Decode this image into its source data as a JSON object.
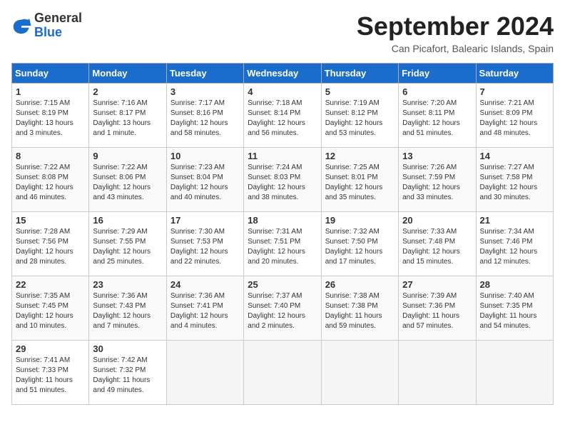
{
  "header": {
    "logo": {
      "general": "General",
      "blue": "Blue"
    },
    "title": "September 2024",
    "location": "Can Picafort, Balearic Islands, Spain"
  },
  "calendar": {
    "days_of_week": [
      "Sunday",
      "Monday",
      "Tuesday",
      "Wednesday",
      "Thursday",
      "Friday",
      "Saturday"
    ],
    "weeks": [
      [
        null,
        {
          "day": "2",
          "sunrise": "Sunrise: 7:16 AM",
          "sunset": "Sunset: 8:17 PM",
          "daylight": "Daylight: 13 hours and 1 minute."
        },
        {
          "day": "3",
          "sunrise": "Sunrise: 7:17 AM",
          "sunset": "Sunset: 8:16 PM",
          "daylight": "Daylight: 12 hours and 58 minutes."
        },
        {
          "day": "4",
          "sunrise": "Sunrise: 7:18 AM",
          "sunset": "Sunset: 8:14 PM",
          "daylight": "Daylight: 12 hours and 56 minutes."
        },
        {
          "day": "5",
          "sunrise": "Sunrise: 7:19 AM",
          "sunset": "Sunset: 8:12 PM",
          "daylight": "Daylight: 12 hours and 53 minutes."
        },
        {
          "day": "6",
          "sunrise": "Sunrise: 7:20 AM",
          "sunset": "Sunset: 8:11 PM",
          "daylight": "Daylight: 12 hours and 51 minutes."
        },
        {
          "day": "7",
          "sunrise": "Sunrise: 7:21 AM",
          "sunset": "Sunset: 8:09 PM",
          "daylight": "Daylight: 12 hours and 48 minutes."
        }
      ],
      [
        {
          "day": "1",
          "sunrise": "Sunrise: 7:15 AM",
          "sunset": "Sunset: 8:19 PM",
          "daylight": "Daylight: 13 hours and 3 minutes."
        },
        null,
        null,
        null,
        null,
        null,
        null
      ],
      [
        {
          "day": "8",
          "sunrise": "Sunrise: 7:22 AM",
          "sunset": "Sunset: 8:08 PM",
          "daylight": "Daylight: 12 hours and 46 minutes."
        },
        {
          "day": "9",
          "sunrise": "Sunrise: 7:22 AM",
          "sunset": "Sunset: 8:06 PM",
          "daylight": "Daylight: 12 hours and 43 minutes."
        },
        {
          "day": "10",
          "sunrise": "Sunrise: 7:23 AM",
          "sunset": "Sunset: 8:04 PM",
          "daylight": "Daylight: 12 hours and 40 minutes."
        },
        {
          "day": "11",
          "sunrise": "Sunrise: 7:24 AM",
          "sunset": "Sunset: 8:03 PM",
          "daylight": "Daylight: 12 hours and 38 minutes."
        },
        {
          "day": "12",
          "sunrise": "Sunrise: 7:25 AM",
          "sunset": "Sunset: 8:01 PM",
          "daylight": "Daylight: 12 hours and 35 minutes."
        },
        {
          "day": "13",
          "sunrise": "Sunrise: 7:26 AM",
          "sunset": "Sunset: 7:59 PM",
          "daylight": "Daylight: 12 hours and 33 minutes."
        },
        {
          "day": "14",
          "sunrise": "Sunrise: 7:27 AM",
          "sunset": "Sunset: 7:58 PM",
          "daylight": "Daylight: 12 hours and 30 minutes."
        }
      ],
      [
        {
          "day": "15",
          "sunrise": "Sunrise: 7:28 AM",
          "sunset": "Sunset: 7:56 PM",
          "daylight": "Daylight: 12 hours and 28 minutes."
        },
        {
          "day": "16",
          "sunrise": "Sunrise: 7:29 AM",
          "sunset": "Sunset: 7:55 PM",
          "daylight": "Daylight: 12 hours and 25 minutes."
        },
        {
          "day": "17",
          "sunrise": "Sunrise: 7:30 AM",
          "sunset": "Sunset: 7:53 PM",
          "daylight": "Daylight: 12 hours and 22 minutes."
        },
        {
          "day": "18",
          "sunrise": "Sunrise: 7:31 AM",
          "sunset": "Sunset: 7:51 PM",
          "daylight": "Daylight: 12 hours and 20 minutes."
        },
        {
          "day": "19",
          "sunrise": "Sunrise: 7:32 AM",
          "sunset": "Sunset: 7:50 PM",
          "daylight": "Daylight: 12 hours and 17 minutes."
        },
        {
          "day": "20",
          "sunrise": "Sunrise: 7:33 AM",
          "sunset": "Sunset: 7:48 PM",
          "daylight": "Daylight: 12 hours and 15 minutes."
        },
        {
          "day": "21",
          "sunrise": "Sunrise: 7:34 AM",
          "sunset": "Sunset: 7:46 PM",
          "daylight": "Daylight: 12 hours and 12 minutes."
        }
      ],
      [
        {
          "day": "22",
          "sunrise": "Sunrise: 7:35 AM",
          "sunset": "Sunset: 7:45 PM",
          "daylight": "Daylight: 12 hours and 10 minutes."
        },
        {
          "day": "23",
          "sunrise": "Sunrise: 7:36 AM",
          "sunset": "Sunset: 7:43 PM",
          "daylight": "Daylight: 12 hours and 7 minutes."
        },
        {
          "day": "24",
          "sunrise": "Sunrise: 7:36 AM",
          "sunset": "Sunset: 7:41 PM",
          "daylight": "Daylight: 12 hours and 4 minutes."
        },
        {
          "day": "25",
          "sunrise": "Sunrise: 7:37 AM",
          "sunset": "Sunset: 7:40 PM",
          "daylight": "Daylight: 12 hours and 2 minutes."
        },
        {
          "day": "26",
          "sunrise": "Sunrise: 7:38 AM",
          "sunset": "Sunset: 7:38 PM",
          "daylight": "Daylight: 11 hours and 59 minutes."
        },
        {
          "day": "27",
          "sunrise": "Sunrise: 7:39 AM",
          "sunset": "Sunset: 7:36 PM",
          "daylight": "Daylight: 11 hours and 57 minutes."
        },
        {
          "day": "28",
          "sunrise": "Sunrise: 7:40 AM",
          "sunset": "Sunset: 7:35 PM",
          "daylight": "Daylight: 11 hours and 54 minutes."
        }
      ],
      [
        {
          "day": "29",
          "sunrise": "Sunrise: 7:41 AM",
          "sunset": "Sunset: 7:33 PM",
          "daylight": "Daylight: 11 hours and 51 minutes."
        },
        {
          "day": "30",
          "sunrise": "Sunrise: 7:42 AM",
          "sunset": "Sunset: 7:32 PM",
          "daylight": "Daylight: 11 hours and 49 minutes."
        },
        null,
        null,
        null,
        null,
        null
      ]
    ]
  }
}
